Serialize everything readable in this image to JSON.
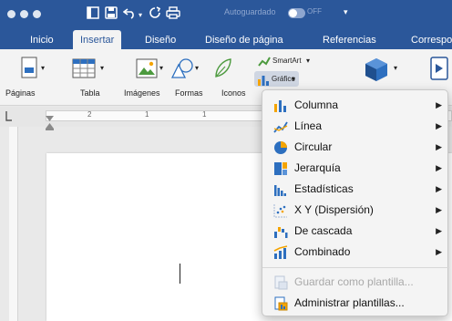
{
  "titlebar": {
    "autosave_label": "Autoguardado",
    "autosave_toggle": "OFF",
    "more": "▾"
  },
  "tabs": [
    {
      "label": "Inicio"
    },
    {
      "label": "Insertar"
    },
    {
      "label": "Diseño"
    },
    {
      "label": "Diseño de página"
    },
    {
      "label": "Referencias"
    },
    {
      "label": "Correspo"
    }
  ],
  "ribbon": {
    "paginas": "Páginas",
    "tabla": "Tabla",
    "imagenes": "Imágenes",
    "formas": "Formas",
    "iconos": "Iconos",
    "smartart": "SmartArt",
    "grafico": "Gráfico",
    "dropdown_glyph": "▾"
  },
  "ruler": {
    "marks": [
      "2",
      "1",
      "1"
    ]
  },
  "menu": {
    "items": [
      {
        "label": "Columna",
        "icon": "column-chart-icon",
        "submenu": true
      },
      {
        "label": "Línea",
        "icon": "line-chart-icon",
        "submenu": true
      },
      {
        "label": "Circular",
        "icon": "pie-chart-icon",
        "submenu": true
      },
      {
        "label": "Jerarquía",
        "icon": "hierarchy-chart-icon",
        "submenu": true
      },
      {
        "label": "Estadísticas",
        "icon": "statistics-chart-icon",
        "submenu": true
      },
      {
        "label": "X Y (Dispersión)",
        "icon": "scatter-chart-icon",
        "submenu": true
      },
      {
        "label": "De cascada",
        "icon": "waterfall-chart-icon",
        "submenu": true
      },
      {
        "label": "Combinado",
        "icon": "combo-chart-icon",
        "submenu": true
      }
    ],
    "save_template": "Guardar como plantilla...",
    "manage_templates": "Administrar plantillas...",
    "arrow": "▶"
  },
  "colors": {
    "brand_blue": "#2b579a",
    "chart_blue": "#2d6fbf",
    "chart_orange": "#f4a400"
  }
}
